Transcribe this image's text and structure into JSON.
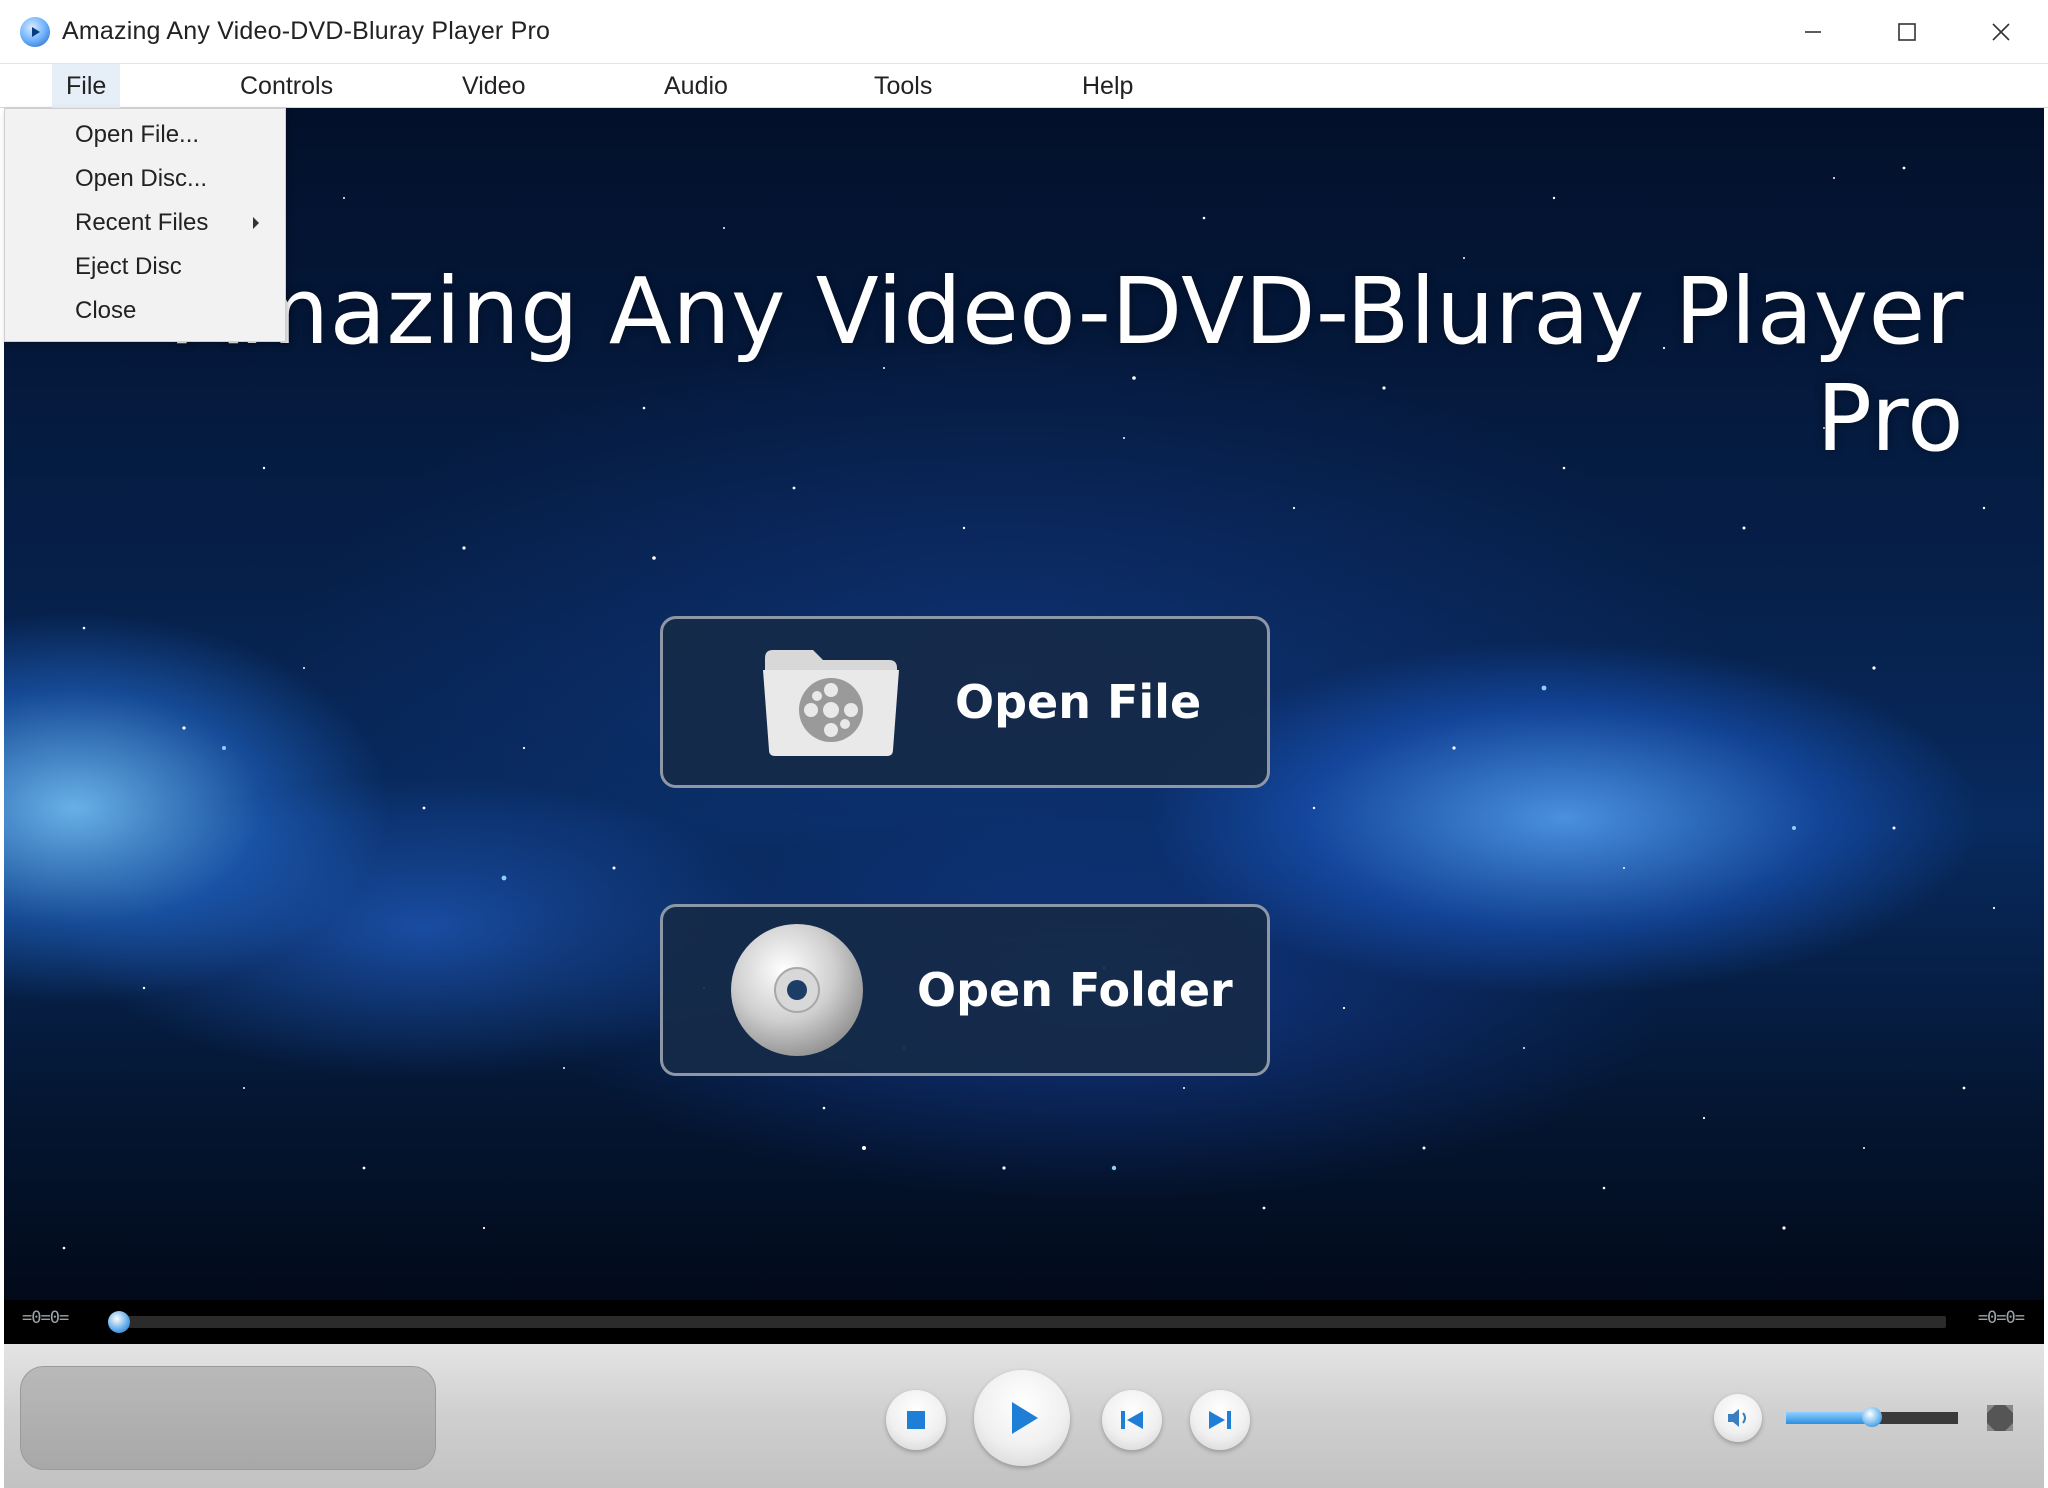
{
  "window": {
    "title": "Amazing Any Video-DVD-Bluray Player Pro",
    "icons": {
      "app": "play-icon",
      "minimize": "minimize-icon",
      "maximize": "maximize-icon",
      "close": "close-icon"
    }
  },
  "menubar": {
    "items": [
      {
        "label": "File",
        "active": true
      },
      {
        "label": "Controls"
      },
      {
        "label": "Video"
      },
      {
        "label": "Audio"
      },
      {
        "label": "Tools"
      },
      {
        "label": "Help"
      }
    ]
  },
  "file_menu": {
    "items": [
      {
        "label": "Open File..."
      },
      {
        "label": "Open Disc..."
      },
      {
        "label": "Recent Files",
        "submenu": true
      },
      {
        "label": "Eject Disc"
      },
      {
        "label": "Close"
      }
    ]
  },
  "main": {
    "title": "Amazing Any Video-DVD-Bluray Player Pro",
    "open_file": {
      "label": "Open File",
      "icon": "film-folder-icon"
    },
    "open_folder": {
      "label": "Open Folder",
      "icon": "disc-icon"
    }
  },
  "seekbar": {
    "time_left": "=0=0=",
    "time_right": "=0=0=",
    "progress": 0
  },
  "controls": {
    "stop_icon": "stop-icon",
    "play_icon": "play-icon",
    "prev_icon": "previous-icon",
    "next_icon": "next-icon",
    "volume_icon": "volume-icon",
    "fullscreen_icon": "fullscreen-icon",
    "volume_level": 0.5
  },
  "colors": {
    "accent": "#2c8fe0",
    "button_bg": "#162a48",
    "control_bar": "#cfcfcf"
  }
}
